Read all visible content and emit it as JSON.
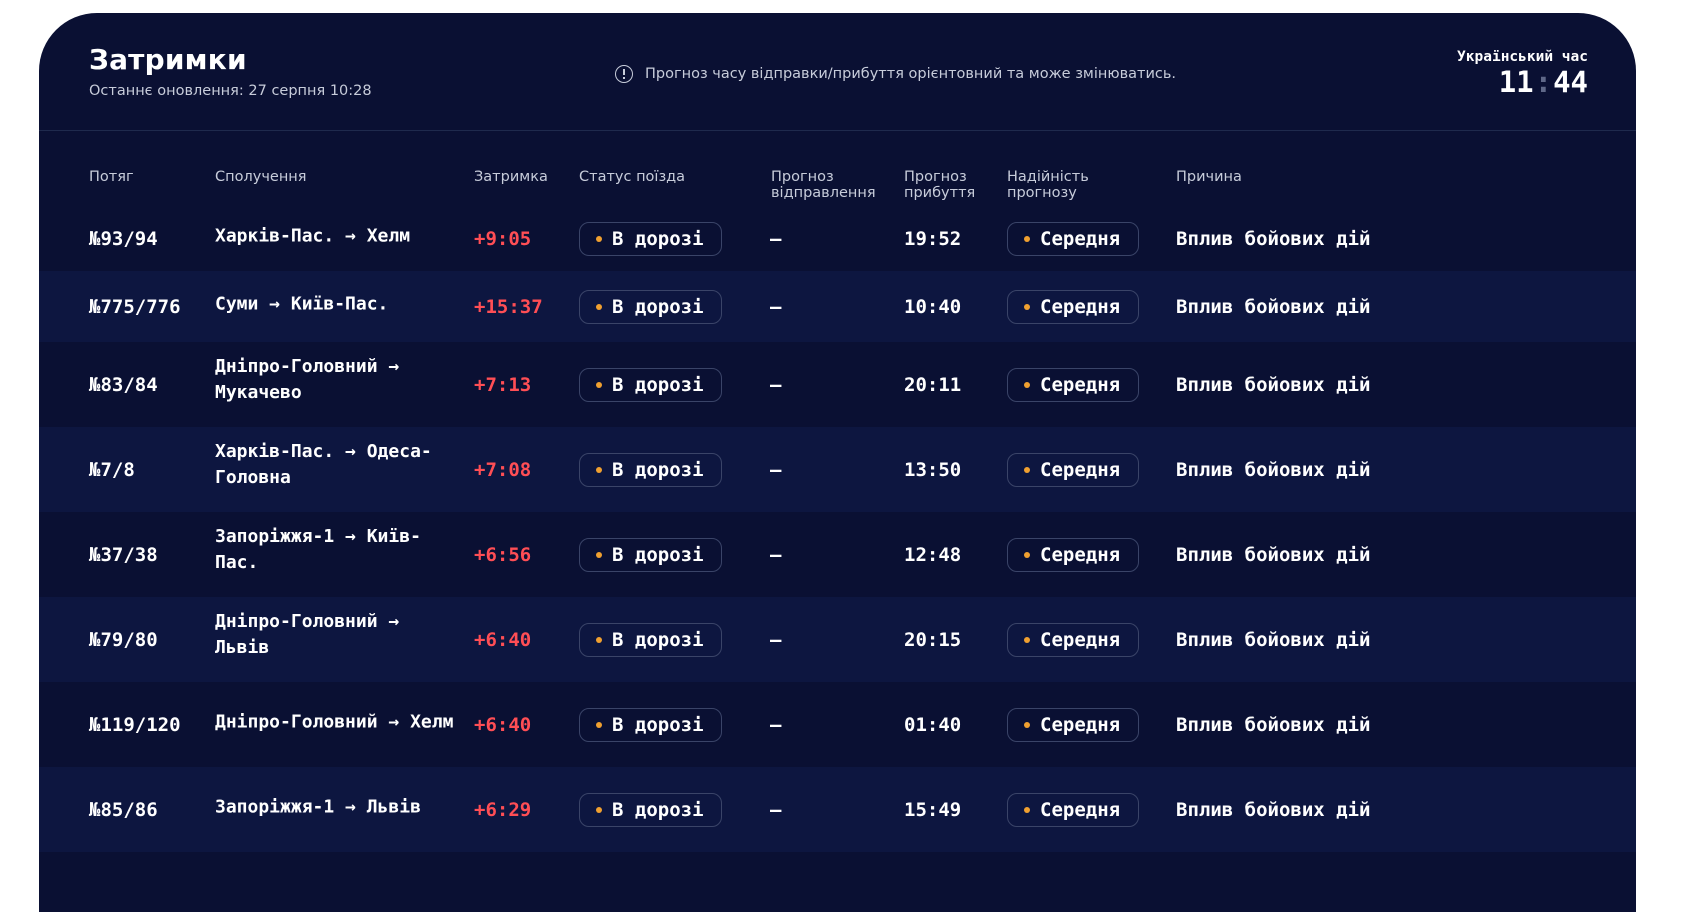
{
  "header": {
    "title": "Затримки",
    "updated": "Останнє оновлення: 27 серпня 10:28",
    "notice": "Прогноз часу відправки/прибуття орієнтовний та може змінюватись.",
    "clock_label": "Український час",
    "clock_hours": "11",
    "clock_sep": ":",
    "clock_minutes": "44"
  },
  "columns": {
    "train": "Потяг",
    "route": "Сполучення",
    "delay": "Затримка",
    "status": "Статус поїзда",
    "dep_forecast": "Прогноз відправлення",
    "arr_forecast": "Прогноз прибуття",
    "reliability": "Надійність прогнозу",
    "reason": "Причина"
  },
  "colors": {
    "background": "#0a1033",
    "row_alt": "#0d1640",
    "delay": "#ff4e55",
    "dot": "#f0a030"
  },
  "rows": [
    {
      "train": "№93/94",
      "route": "Харків-Пас. → Хелм",
      "delay": "+9:05",
      "status": "В дорозі",
      "dep": "—",
      "arr": "19:52",
      "reliability": "Середня",
      "reason": "Вплив бойових дій"
    },
    {
      "train": "№775/776",
      "route": "Суми → Київ-Пас.",
      "delay": "+15:37",
      "status": "В дорозі",
      "dep": "—",
      "arr": "10:40",
      "reliability": "Середня",
      "reason": "Вплив бойових дій"
    },
    {
      "train": "№83/84",
      "route": "Дніпро-Головний → Мукачево",
      "delay": "+7:13",
      "status": "В дорозі",
      "dep": "—",
      "arr": "20:11",
      "reliability": "Середня",
      "reason": "Вплив бойових дій"
    },
    {
      "train": "№7/8",
      "route": "Харків-Пас. → Одеса-Головна",
      "delay": "+7:08",
      "status": "В дорозі",
      "dep": "—",
      "arr": "13:50",
      "reliability": "Середня",
      "reason": "Вплив бойових дій"
    },
    {
      "train": "№37/38",
      "route": "Запоріжжя-1 → Київ-Пас.",
      "delay": "+6:56",
      "status": "В дорозі",
      "dep": "—",
      "arr": "12:48",
      "reliability": "Середня",
      "reason": "Вплив бойових дій"
    },
    {
      "train": "№79/80",
      "route": "Дніпро-Головний → Львів",
      "delay": "+6:40",
      "status": "В дорозі",
      "dep": "—",
      "arr": "20:15",
      "reliability": "Середня",
      "reason": "Вплив бойових дій"
    },
    {
      "train": "№119/120",
      "route": "Дніпро-Головний → Хелм",
      "delay": "+6:40",
      "status": "В дорозі",
      "dep": "—",
      "arr": "01:40",
      "reliability": "Середня",
      "reason": "Вплив бойових дій"
    },
    {
      "train": "№85/86",
      "route": "Запоріжжя-1 → Львів",
      "delay": "+6:29",
      "status": "В дорозі",
      "dep": "—",
      "arr": "15:49",
      "reliability": "Середня",
      "reason": "Вплив бойових дій"
    }
  ]
}
